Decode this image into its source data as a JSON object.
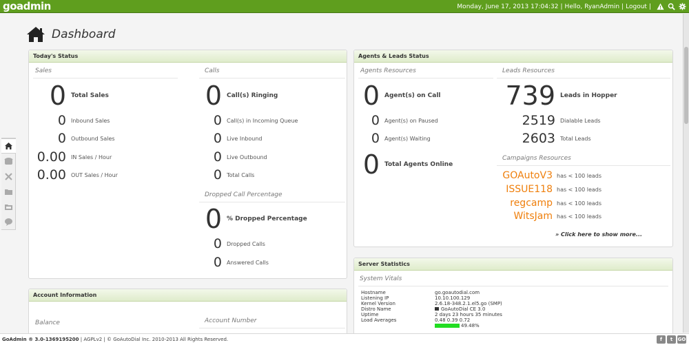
{
  "app": {
    "logo": "goadmin",
    "datetime": "Monday, June 17, 2013 17:04:32",
    "greeting": "Hello, RyanAdmin",
    "logout": "Logout"
  },
  "page": {
    "title": "Dashboard"
  },
  "todays_status": {
    "title": "Today's Status",
    "sales": {
      "heading": "Sales",
      "total": {
        "value": "0",
        "label": "Total Sales"
      },
      "inbound": {
        "value": "0",
        "label": "Inbound Sales"
      },
      "outbound": {
        "value": "0",
        "label": "Outbound Sales"
      },
      "in_per_hour": {
        "value": "0.00",
        "label": "IN Sales / Hour"
      },
      "out_per_hour": {
        "value": "0.00",
        "label": "OUT Sales / Hour"
      }
    },
    "calls": {
      "heading": "Calls",
      "ringing": {
        "value": "0",
        "label": "Call(s) Ringing"
      },
      "incoming_queue": {
        "value": "0",
        "label": "Call(s) in Incoming Queue"
      },
      "live_inbound": {
        "value": "0",
        "label": "Live Inbound"
      },
      "live_outbound": {
        "value": "0",
        "label": "Live Outbound"
      },
      "total_calls": {
        "value": "0",
        "label": "Total Calls"
      }
    },
    "dropped": {
      "heading": "Dropped Call Percentage",
      "percentage": {
        "value": "0",
        "label": "% Dropped Percentage"
      },
      "dropped_calls": {
        "value": "0",
        "label": "Dropped Calls"
      },
      "answered_calls": {
        "value": "0",
        "label": "Answered Calls"
      }
    }
  },
  "agents_leads": {
    "title": "Agents & Leads Status",
    "agents": {
      "heading": "Agents Resources",
      "on_call": {
        "value": "0",
        "label": "Agent(s) on Call"
      },
      "on_paused": {
        "value": "0",
        "label": "Agent(s) on Paused"
      },
      "waiting": {
        "value": "0",
        "label": "Agent(s) Waiting"
      },
      "online": {
        "value": "0",
        "label": "Total Agents Online"
      }
    },
    "leads": {
      "heading": "Leads Resources",
      "hopper": {
        "value": "739",
        "label": "Leads in Hopper"
      },
      "dialable": {
        "value": "2519",
        "label": "Dialable Leads"
      },
      "total": {
        "value": "2603",
        "label": "Total Leads"
      }
    },
    "campaigns": {
      "heading": "Campaigns Resources",
      "items": [
        {
          "name": "GOAutoV3",
          "note": "has < 100 leads"
        },
        {
          "name": "ISSUE118",
          "note": "has < 100 leads"
        },
        {
          "name": "regcamp",
          "note": "has < 100 leads"
        },
        {
          "name": "WitsJam",
          "note": "has < 100 leads"
        }
      ],
      "more_link": "» Click here to show more..."
    }
  },
  "server_stats": {
    "title": "Server Statistics",
    "heading": "System Vitals",
    "rows": [
      {
        "key": "Hostname",
        "value": "go.goautodial.com"
      },
      {
        "key": "Listening IP",
        "value": "10.10.100.129"
      },
      {
        "key": "Kernel Version",
        "value": "2.6.18-348.2.1.el5.go (SMP)"
      },
      {
        "key": "Distro Name",
        "value": "GoAutoDial CE 3.0"
      },
      {
        "key": "Uptime",
        "value": "2 days 23 hours 35 minutes"
      },
      {
        "key": "Load Averages",
        "value": "0.48 0.39 0.72"
      }
    ],
    "cpu_usage": 0.4948,
    "cpu_label": "49.48%"
  },
  "account": {
    "title": "Account Information",
    "balance_label": "Balance",
    "account_number_label": "Account Number"
  },
  "footer": {
    "product": "GoAdmin ® 3.0-1369195200",
    "license": "| AGPLv2 | © GoAutoDial Inc. 2010-2013 All Rights Reserved.",
    "social": [
      "f",
      "t",
      "GO"
    ]
  },
  "colors": {
    "brand_green": "#5f9e1e",
    "campaign_orange": "#ef7f0c",
    "usage_bar": "#22dd22"
  }
}
